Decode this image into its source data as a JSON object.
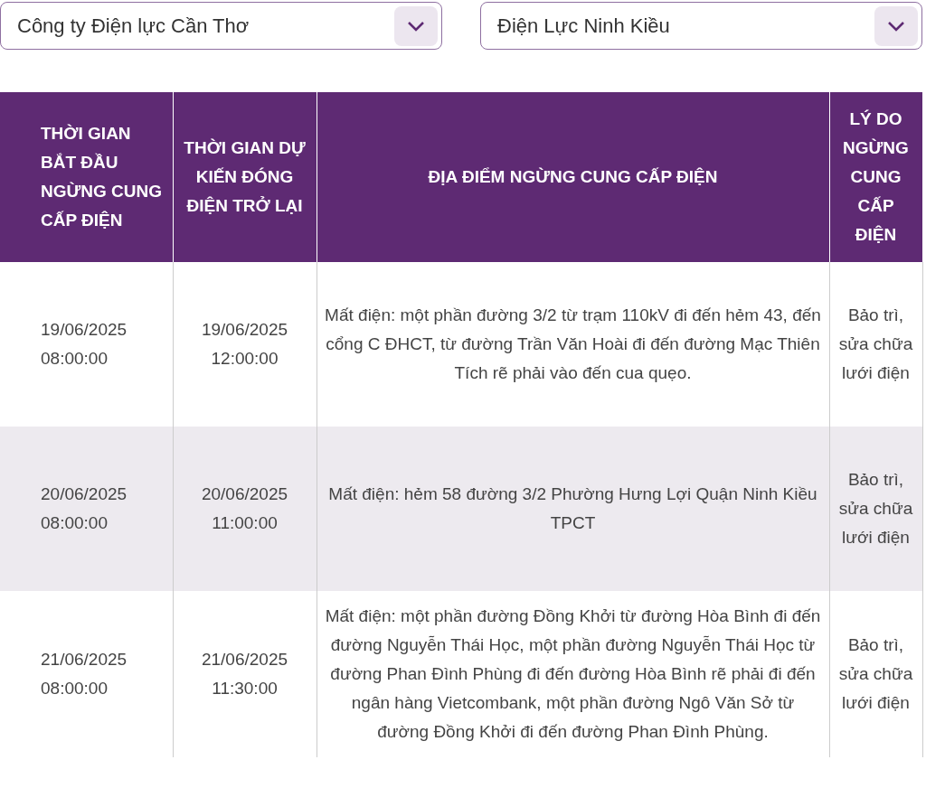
{
  "filters": [
    {
      "value": "Công ty Điện lực Cần Thơ"
    },
    {
      "value": "Điện Lực Ninh Kiều"
    }
  ],
  "table": {
    "columns": [
      "THỜI GIAN BẮT ĐẦU NGỪNG CUNG CẤP ĐIỆN",
      "THỜI GIAN DỰ KIẾN ĐÓNG ĐIỆN TRỞ LẠI",
      "ĐỊA ĐIỂM NGỪNG CUNG CẤP ĐIỆN",
      "LÝ DO NGỪNG CUNG CẤP ĐIỆN"
    ],
    "rows": [
      {
        "start": "19/06/2025 08:00:00",
        "end": "19/06/2025 12:00:00",
        "location": "Mất điện: một phần đường 3/2 từ trạm 110kV đi đến hẻm 43, đến cổng C ĐHCT, từ đường Trần Văn Hoài đi đến đường Mạc Thiên Tích rẽ phải vào đến cua quẹo.",
        "reason": "Bảo trì, sửa chữa lưới điện"
      },
      {
        "start": "20/06/2025 08:00:00",
        "end": "20/06/2025 11:00:00",
        "location": "Mất điện: hẻm 58 đường 3/2 Phường Hưng Lợi Quận Ninh Kiều TPCT",
        "reason": "Bảo trì, sửa chữa lưới điện"
      },
      {
        "start": "21/06/2025 08:00:00",
        "end": "21/06/2025 11:30:00",
        "location": "Mất điện: một phần đường Đồng Khởi từ đường Hòa Bình đi đến đường Nguyễn Thái Học, một phần đường Nguyễn Thái Học từ đường Phan Đình Phùng đi đến đường Hòa Bình rẽ phải đi đến ngân hàng Vietcombank, một phần đường Ngô Văn Sở từ đường Đồng Khởi đi đến đường Phan Đình Phùng.",
        "reason": "Bảo trì, sửa chữa lưới điện"
      }
    ]
  }
}
